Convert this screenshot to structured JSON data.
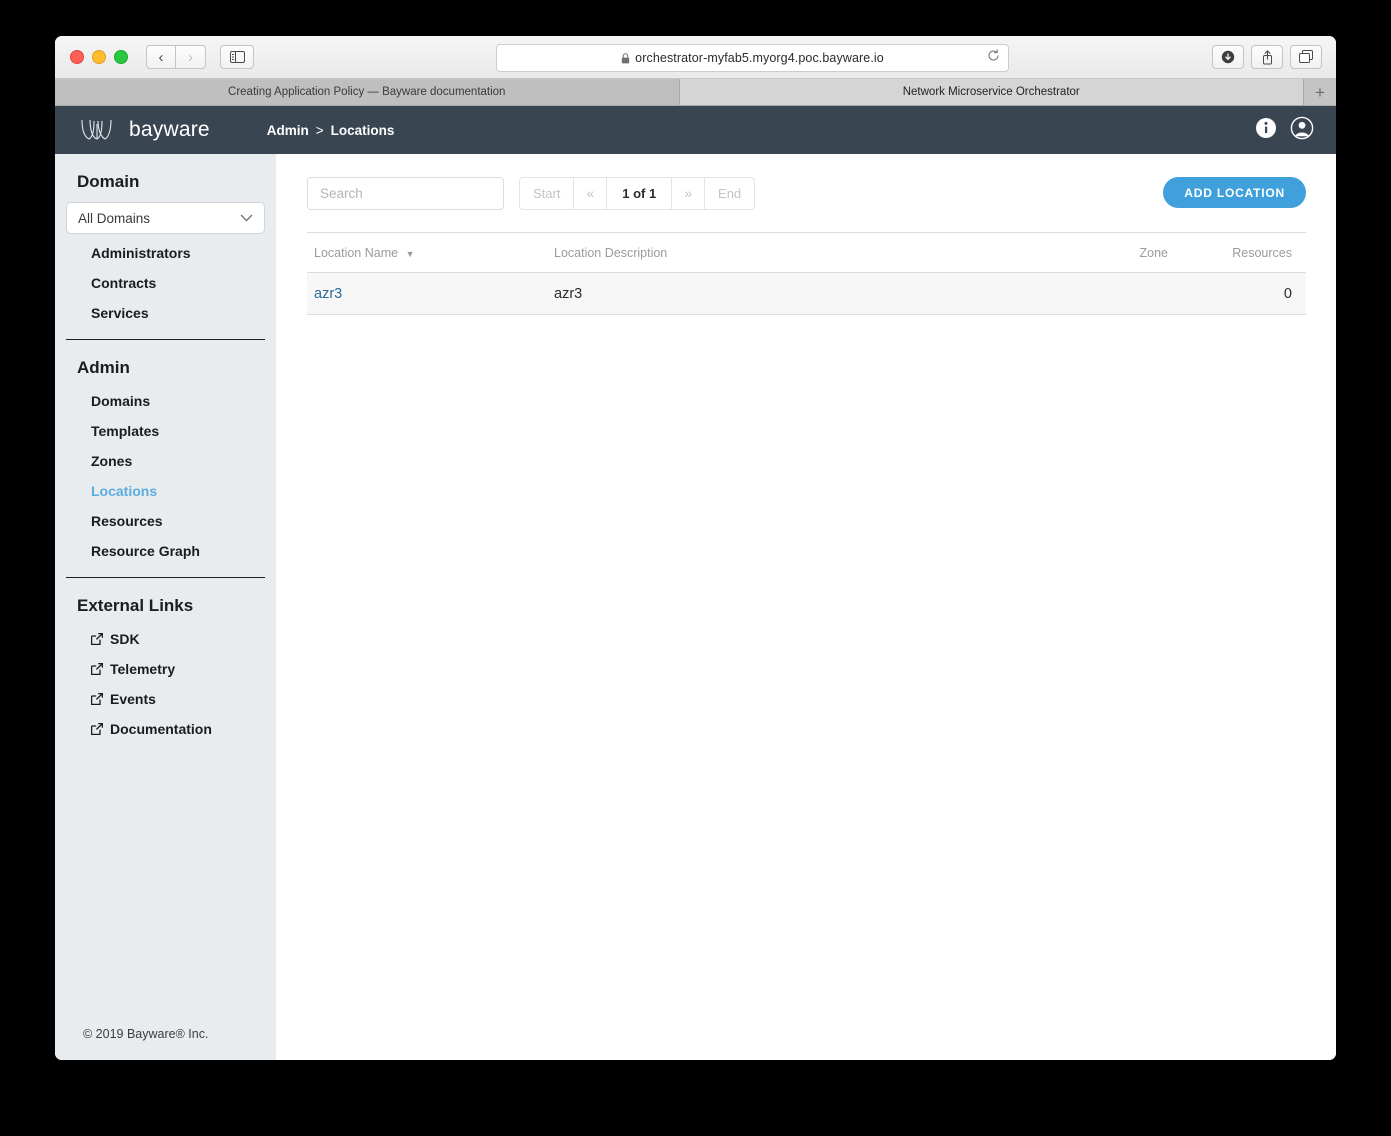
{
  "browser": {
    "url": "orchestrator-myfab5.myorg4.poc.bayware.io",
    "back_icon": "back-chevron-icon",
    "forward_icon": "forward-chevron-icon",
    "sidebar_icon": "sidebar-toggle-icon",
    "lock_icon": "lock-icon",
    "reload_icon": "reload-icon",
    "download_icon": "download-icon",
    "share_icon": "share-icon",
    "tabs_icon": "tab-overview-icon",
    "new_tab_label": "+",
    "tabs": [
      {
        "title": "Creating Application Policy — Bayware documentation",
        "active": false
      },
      {
        "title": "Network Microservice Orchestrator",
        "active": true
      }
    ]
  },
  "header": {
    "logo_text": "bayware",
    "breadcrumb": {
      "root": "Admin",
      "separator": ">",
      "current": "Locations"
    },
    "info_icon": "info-icon",
    "account_icon": "user-account-icon"
  },
  "sidebar": {
    "domain_section_title": "Domain",
    "domain_select_value": "All Domains",
    "domain_items": [
      {
        "label": "Administrators",
        "active": false
      },
      {
        "label": "Contracts",
        "active": false
      },
      {
        "label": "Services",
        "active": false
      }
    ],
    "admin_section_title": "Admin",
    "admin_items": [
      {
        "label": "Domains",
        "active": false
      },
      {
        "label": "Templates",
        "active": false
      },
      {
        "label": "Zones",
        "active": false
      },
      {
        "label": "Locations",
        "active": true
      },
      {
        "label": "Resources",
        "active": false
      },
      {
        "label": "Resource Graph",
        "active": false
      }
    ],
    "external_section_title": "External Links",
    "external_items": [
      {
        "label": "SDK"
      },
      {
        "label": "Telemetry"
      },
      {
        "label": "Events"
      },
      {
        "label": "Documentation"
      }
    ],
    "copyright": "© 2019 Bayware® Inc."
  },
  "toolbar": {
    "search_placeholder": "Search",
    "search_value": "",
    "pager": {
      "start_label": "Start",
      "prev_label": "«",
      "current_label": "1 of 1",
      "next_label": "»",
      "end_label": "End"
    },
    "add_button_label": "ADD LOCATION"
  },
  "table": {
    "columns": [
      {
        "label": "Location Name",
        "sorted": true
      },
      {
        "label": "Location Description",
        "sorted": false
      },
      {
        "label": "Zone",
        "sorted": false
      },
      {
        "label": "Resources",
        "sorted": false
      }
    ],
    "rows": [
      {
        "name": "azr3",
        "description": "azr3",
        "zone": "",
        "resources": "0"
      }
    ]
  },
  "colors": {
    "header_bg": "#3a4552",
    "sidebar_bg": "#e8ecef",
    "accent_blue": "#3fa0db",
    "active_nav": "#5badde",
    "link_blue": "#2b6a96",
    "row_bg": "#f7f7f7"
  }
}
